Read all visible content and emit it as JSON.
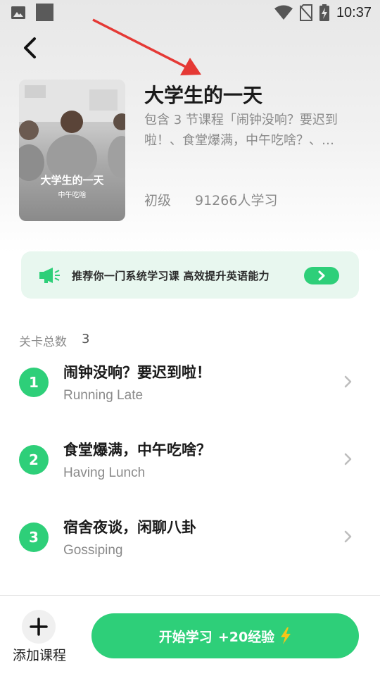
{
  "status_bar": {
    "time": "10:37",
    "icons": [
      "image-icon",
      "square-icon",
      "wifi-icon",
      "no-sim-icon",
      "battery-charging-icon"
    ]
  },
  "nav": {
    "back_icon": "chevron-left-icon"
  },
  "course": {
    "cover_title": "大学生的一天",
    "cover_subtitle": "中午吃啥",
    "title": "大学生的一天",
    "description": "包含 3 节课程「闹钟没响？要迟到啦！、食堂爆满，中午吃啥？、…",
    "level": "初级",
    "learners": "91266人学习"
  },
  "promo": {
    "icon": "megaphone-icon",
    "text": "推荐你一门系统学习课  高效提升英语能力",
    "button_icon": "chevron-right-icon"
  },
  "levels": {
    "label": "关卡总数",
    "count": "3",
    "items": [
      {
        "number": "1",
        "title": "闹钟没响？要迟到啦！",
        "subtitle": "Running Late"
      },
      {
        "number": "2",
        "title": "食堂爆满，中午吃啥？",
        "subtitle": "Having Lunch"
      },
      {
        "number": "3",
        "title": "宿舍夜谈，闲聊八卦",
        "subtitle": "Gossiping"
      }
    ]
  },
  "bottom": {
    "add_label": "添加课程",
    "start_label": "开始学习",
    "exp_label": "+20经验"
  },
  "colors": {
    "accent": "#2ecf79",
    "promo_bg": "#e8f7ef",
    "annotation": "#e53935",
    "lightning": "#f5c518"
  }
}
